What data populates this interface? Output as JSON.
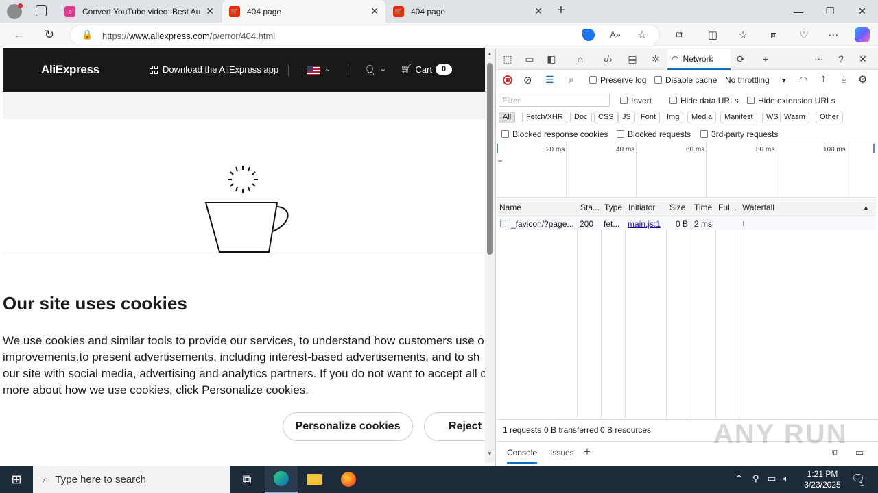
{
  "browser": {
    "tabs": [
      {
        "title": "Convert YouTube video: Best Au",
        "favicon": "mp3-favicon",
        "active": false
      },
      {
        "title": "404 page",
        "favicon": "aliexpress-favicon",
        "active": true
      },
      {
        "title": "404 page",
        "favicon": "aliexpress-favicon",
        "active": false
      }
    ],
    "url_prefix": "https://",
    "url_domain": "www.aliexpress.com",
    "url_path": "/p/error/404.html",
    "window_controls": {
      "minimize": "—",
      "maximize": "❐",
      "close": "✕"
    }
  },
  "site": {
    "logo": "AliExpress",
    "download_app": "Download the AliExpress app",
    "cart_label": "Cart",
    "cart_count": "0"
  },
  "cookie_banner": {
    "title": "Our site uses cookies",
    "lines": [
      "We use cookies and similar tools to provide our services, to understand how customers use o",
      "improvements,to present advertisements, including interest-based advertisements, and to sh",
      "our site with social media, advertising and analytics partners. If you do not want to accept all c",
      "more about how we use cookies, click Personalize cookies."
    ],
    "personalize_button": "Personalize cookies",
    "reject_button": "Reject a"
  },
  "devtools": {
    "active_tab": "Network",
    "preserve_log": "Preserve log",
    "disable_cache": "Disable cache",
    "throttling": "No throttling",
    "filter_placeholder": "Filter",
    "invert": "Invert",
    "hide_data_urls": "Hide data URLs",
    "hide_extension_urls": "Hide extension URLs",
    "type_filters": [
      "All",
      "Fetch/XHR",
      "Doc",
      "CSS",
      "JS",
      "Font",
      "Img",
      "Media",
      "Manifest",
      "WS",
      "Wasm",
      "Other"
    ],
    "blocked_response_cookies": "Blocked response cookies",
    "blocked_requests": "Blocked requests",
    "third_party_requests": "3rd-party requests",
    "overview_ticks": [
      "20 ms",
      "40 ms",
      "60 ms",
      "80 ms",
      "100 ms"
    ],
    "columns": [
      "Name",
      "Sta...",
      "Type",
      "Initiator",
      "Size",
      "Time",
      "Ful...",
      "Waterfall"
    ],
    "requests": [
      {
        "name": "_favicon/?page...",
        "status": "200",
        "type": "fet...",
        "initiator": "main.js:1",
        "size": "0 B",
        "time": "2 ms",
        "fulfilled": ""
      }
    ],
    "summary": {
      "requests": "1 requests",
      "transferred": "0 B transferred",
      "resources": "0 B resources"
    },
    "drawer_tabs": [
      "Console",
      "Issues"
    ]
  },
  "taskbar": {
    "search_placeholder": "Type here to search",
    "time": "1:21 PM",
    "date": "3/23/2025",
    "notification_count": "1"
  },
  "watermark": "ANY RUN"
}
